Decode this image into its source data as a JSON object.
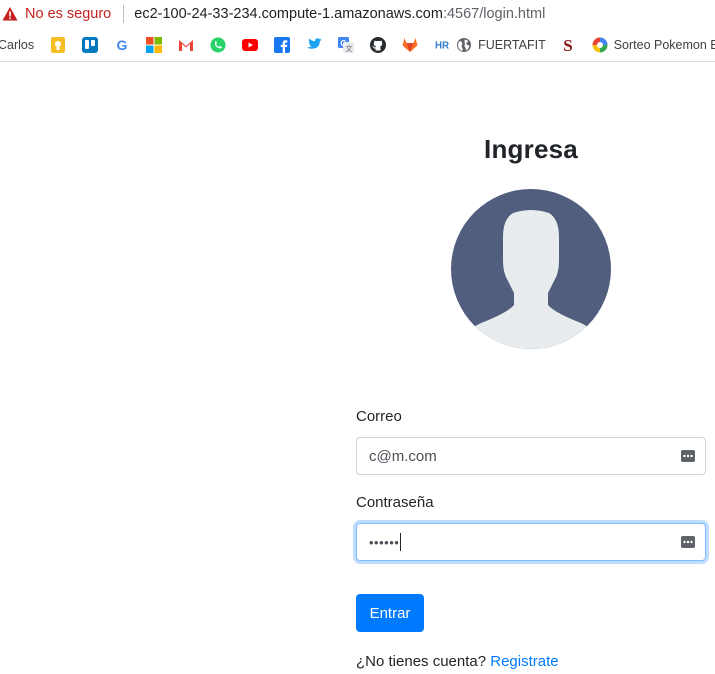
{
  "browser": {
    "security_label": "No es seguro",
    "url_host": "ec2-100-24-33-234.compute-1.amazonaws.com",
    "url_path": ":4567/login.html"
  },
  "bookmarks": {
    "first_label": "Carlos",
    "items": [
      {
        "icon": "keep-icon",
        "label": ""
      },
      {
        "icon": "trello-icon",
        "label": ""
      },
      {
        "icon": "google-icon",
        "label": ""
      },
      {
        "icon": "microsoft-icon",
        "label": ""
      },
      {
        "icon": "gmail-icon",
        "label": ""
      },
      {
        "icon": "whatsapp-icon",
        "label": ""
      },
      {
        "icon": "youtube-icon",
        "label": ""
      },
      {
        "icon": "facebook-icon",
        "label": ""
      },
      {
        "icon": "twitter-icon",
        "label": ""
      },
      {
        "icon": "translate-icon",
        "label": ""
      },
      {
        "icon": "github-icon",
        "label": ""
      },
      {
        "icon": "gitlab-icon",
        "label": ""
      },
      {
        "icon": "hr-icon",
        "label": "HR"
      },
      {
        "icon": "globe-icon",
        "label": "FUERTAFIT"
      },
      {
        "icon": "stanford-icon",
        "label": ""
      },
      {
        "icon": "pokemon-icon",
        "label": "Sorteo Pokemon Es"
      }
    ]
  },
  "login": {
    "title": "Ingresa",
    "email_label": "Correo",
    "email_value": "c@m.com",
    "password_label": "Contraseña",
    "password_mask": "••••••",
    "submit_label": "Entrar",
    "signup_prompt": "¿No tienes cuenta?",
    "signup_link": "Registrate"
  },
  "colors": {
    "primary": "#007bff",
    "avatar_bg": "#525e7e",
    "avatar_figure": "#e8ecee",
    "insecure": "#c5221f"
  }
}
